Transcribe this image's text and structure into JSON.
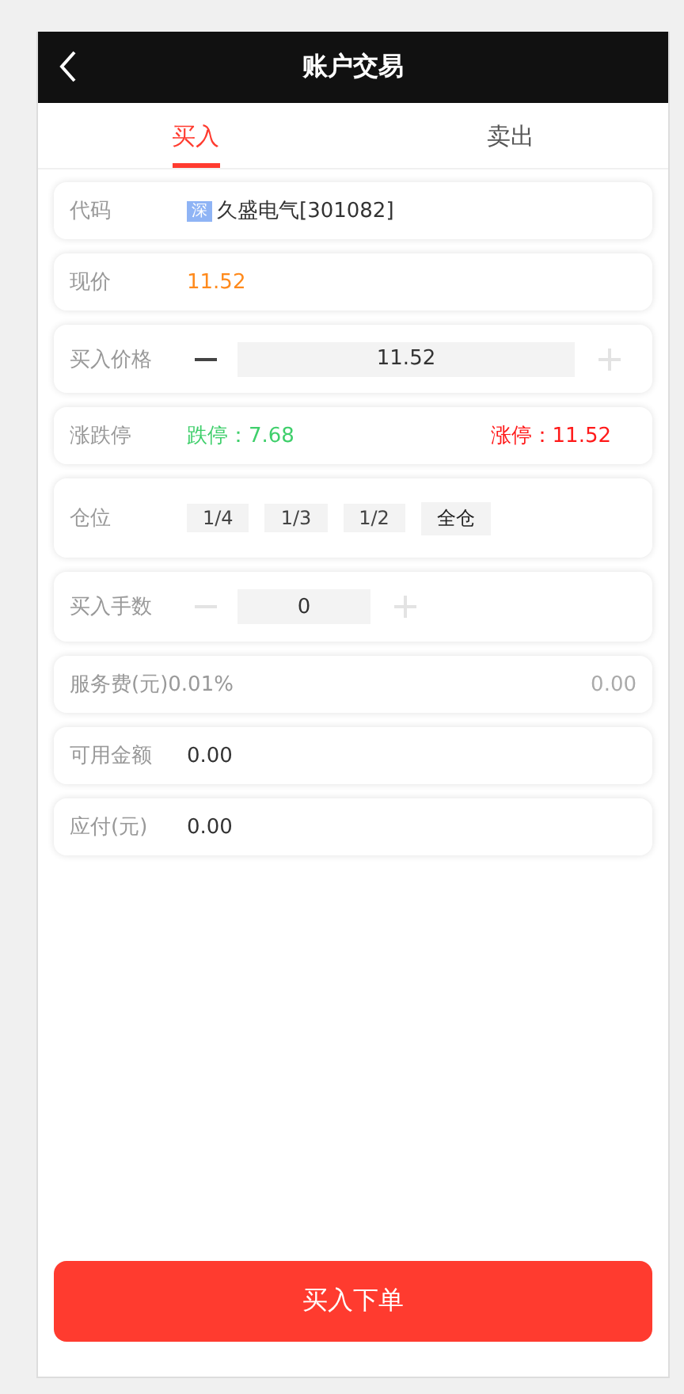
{
  "header": {
    "title": "账户交易"
  },
  "tabs": [
    {
      "label": "买入",
      "selected": true
    },
    {
      "label": "卖出",
      "selected": false
    }
  ],
  "rows": [
    {
      "kind": "stock",
      "label": "代码",
      "badge": "深",
      "value": "久盛电气[301082]"
    },
    {
      "kind": "price",
      "label": "现价",
      "value": "11.52"
    },
    {
      "kind": "stepper",
      "label": "买入价格",
      "value": "11.52",
      "minus_disabled": false,
      "plus_disabled": true,
      "wide": true
    },
    {
      "kind": "limits",
      "label": "涨跌停",
      "low": "跌停：7.68",
      "high": "涨停：11.52"
    },
    {
      "kind": "positions",
      "label": "仓位",
      "options": [
        "1/4",
        "1/3",
        "1/2",
        "全仓"
      ]
    },
    {
      "kind": "stepper",
      "label": "买入手数",
      "value": "0",
      "minus_disabled": true,
      "plus_disabled": true,
      "wide": false
    },
    {
      "kind": "fee",
      "label": "服务费(元)0.01%",
      "value": "0.00"
    },
    {
      "kind": "text",
      "label": "可用金额",
      "value": "0.00"
    },
    {
      "kind": "text",
      "label": "应付(元)",
      "value": "0.00"
    }
  ],
  "submit": "买入下单"
}
